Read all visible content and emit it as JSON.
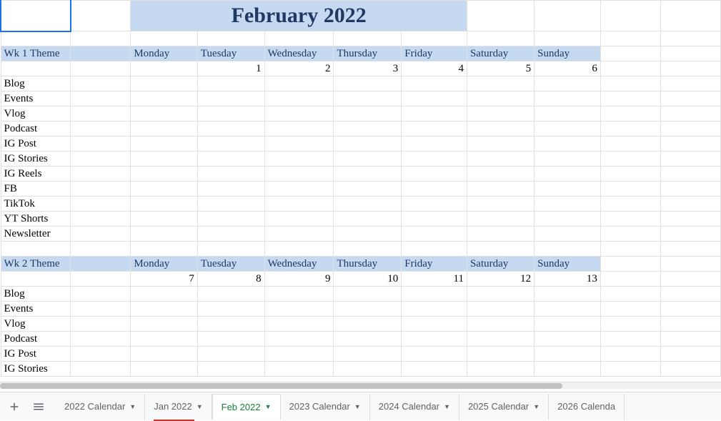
{
  "title": "February 2022",
  "days": [
    "Monday",
    "Tuesday",
    "Wednesday",
    "Thursday",
    "Friday",
    "Saturday",
    "Sunday"
  ],
  "weeks": [
    {
      "theme_label": "Wk 1 Theme",
      "dates": [
        "",
        "1",
        "2",
        "3",
        "4",
        "5",
        "6"
      ]
    },
    {
      "theme_label": "Wk 2 Theme",
      "dates": [
        "7",
        "8",
        "9",
        "10",
        "11",
        "12",
        "13"
      ]
    }
  ],
  "categories": [
    "Blog",
    "Events",
    "Vlog",
    "Podcast",
    "IG Post",
    "IG Stories",
    "IG Reels",
    "FB",
    "TikTok",
    "YT Shorts",
    "Newsletter"
  ],
  "categories_partial": [
    "Blog",
    "Events",
    "Vlog",
    "Podcast",
    "IG Post",
    "IG Stories"
  ],
  "tabs": [
    {
      "label": "2022 Calendar",
      "active": false,
      "underline": false
    },
    {
      "label": "Jan 2022",
      "active": false,
      "underline": true
    },
    {
      "label": "Feb 2022",
      "active": true,
      "underline": false
    },
    {
      "label": "2023 Calendar",
      "active": false,
      "underline": false
    },
    {
      "label": "2024 Calendar",
      "active": false,
      "underline": false
    },
    {
      "label": "2025 Calendar",
      "active": false,
      "underline": false
    },
    {
      "label": "2026 Calenda",
      "active": false,
      "underline": false
    }
  ]
}
